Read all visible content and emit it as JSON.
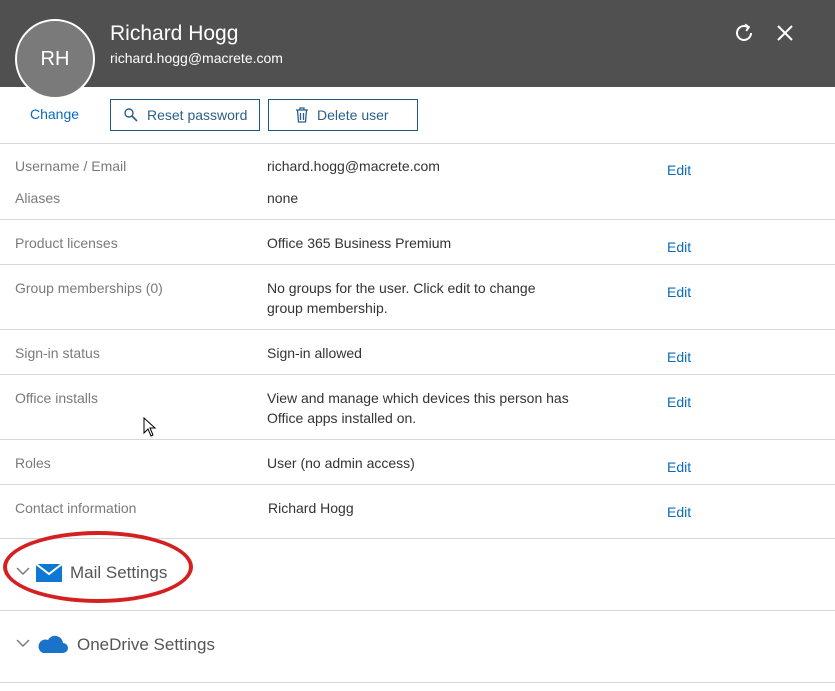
{
  "user": {
    "initials": "RH",
    "name": "Richard Hogg",
    "email": "richard.hogg@macrete.com"
  },
  "header_icons": [
    "refresh-icon",
    "close-icon"
  ],
  "actions": {
    "change_label": "Change",
    "reset_password_label": "Reset password",
    "delete_user_label": "Delete user"
  },
  "details": {
    "edit_label": "Edit",
    "username_label": "Username / Email",
    "username_value": "richard.hogg@macrete.com",
    "aliases_label": "Aliases",
    "aliases_value": "none",
    "licenses_label": "Product licenses",
    "licenses_value": "Office 365 Business Premium",
    "groups_label": "Group memberships (0)",
    "groups_value_line1": "No groups for the user. Click edit to change",
    "groups_value_line2": "group membership.",
    "signin_label": "Sign-in status",
    "signin_value": "Sign-in allowed",
    "installs_label": "Office installs",
    "installs_value_line1": "View and manage which devices this person has",
    "installs_value_line2": "Office apps installed on.",
    "roles_label": "Roles",
    "roles_value": "User (no admin access)",
    "contact_label": "Contact information",
    "contact_value": "Richard Hogg"
  },
  "sections": {
    "mail": "Mail Settings",
    "onedrive": "OneDrive Settings"
  },
  "colors": {
    "header_bg": "#505050",
    "link": "#0a6bbd",
    "annotation": "#d42020",
    "mail_icon": "#0f78d4",
    "onedrive_icon": "#1a73c9"
  }
}
